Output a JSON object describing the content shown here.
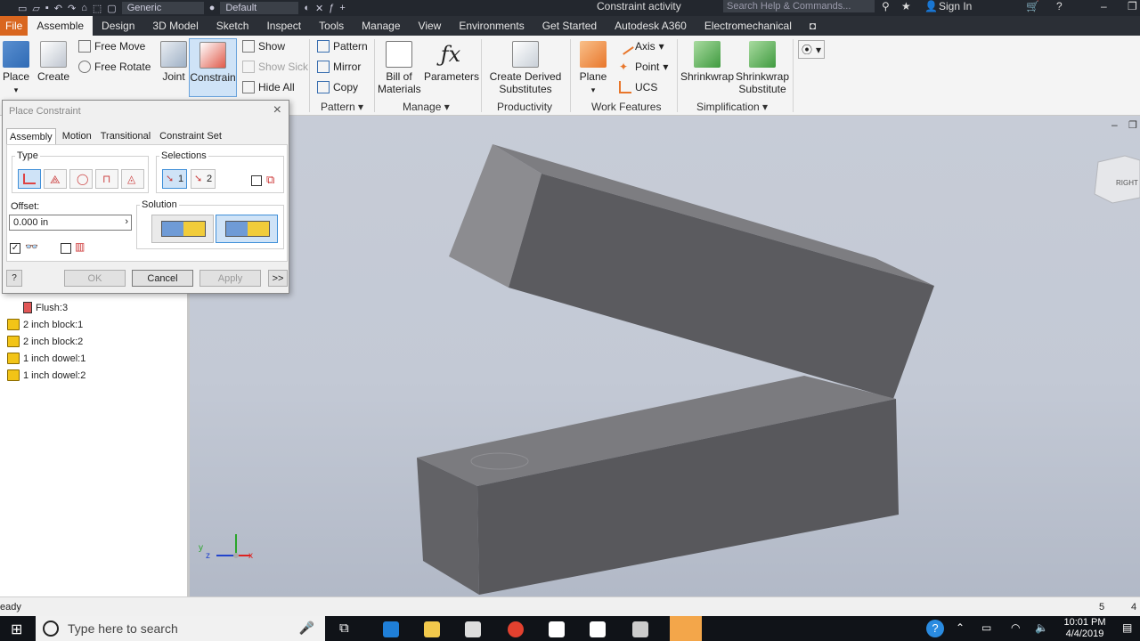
{
  "titlebar": {
    "material": "Generic",
    "appearance": "Default",
    "title": "Constraint activity",
    "search_placeholder": "Search Help & Commands...",
    "signin": "Sign In"
  },
  "tabs": [
    "File",
    "Assemble",
    "Design",
    "3D Model",
    "Sketch",
    "Inspect",
    "Tools",
    "Manage",
    "View",
    "Environments",
    "Get Started",
    "Autodesk A360",
    "Electromechanical"
  ],
  "active_tab": "Assemble",
  "ribbon": {
    "place": "Place",
    "create": "Create",
    "free_move": "Free Move",
    "free_rotate": "Free Rotate",
    "joint": "Joint",
    "constrain": "Constrain",
    "show": "Show",
    "show_sick": "Show Sick",
    "hide_all": "Hide All",
    "pattern": "Pattern",
    "mirror": "Mirror",
    "copy": "Copy",
    "bom_line1": "Bill of",
    "bom_line2": "Materials",
    "parameters": "Parameters",
    "derived_line1": "Create Derived",
    "derived_line2": "Substitutes",
    "plane": "Plane",
    "axis": "Axis",
    "point": "Point",
    "ucs": "UCS",
    "shrinkwrap": "Shrinkwrap",
    "shrinkwrap_sub_line1": "Shrinkwrap",
    "shrinkwrap_sub_line2": "Substitute",
    "panels": {
      "pattern": "Pattern",
      "manage": "Manage",
      "productivity": "Productivity",
      "work_features": "Work Features",
      "simplification": "Simplification"
    }
  },
  "dialog": {
    "title": "Place Constraint",
    "tabs": [
      "Assembly",
      "Motion",
      "Transitional",
      "Constraint Set"
    ],
    "type_label": "Type",
    "selections_label": "Selections",
    "sel1": "1",
    "sel2": "2",
    "offset_label": "Offset:",
    "offset_value": "0.000 in",
    "solution_label": "Solution",
    "ok": "OK",
    "cancel": "Cancel",
    "apply": "Apply",
    "more": ">>"
  },
  "browser": {
    "items": [
      {
        "label": "Flush:3",
        "type": "constraint"
      },
      {
        "label": "2 inch block:1",
        "type": "part"
      },
      {
        "label": "2 inch block:2",
        "type": "part"
      },
      {
        "label": "1 inch dowel:1",
        "type": "part"
      },
      {
        "label": "1 inch dowel:2",
        "type": "part"
      }
    ]
  },
  "viewcube": {
    "face": "RIGHT"
  },
  "status": {
    "text": "eady",
    "count1": "5",
    "count2": "4"
  },
  "taskbar": {
    "search_placeholder": "Type here to search",
    "time": "10:01 PM",
    "date": "4/4/2019"
  },
  "colors": {
    "file_tab": "#d9661f",
    "part_icon": "#f2c417",
    "block_face_top": "#7b7b7f",
    "block_face_front": "#58585c"
  }
}
